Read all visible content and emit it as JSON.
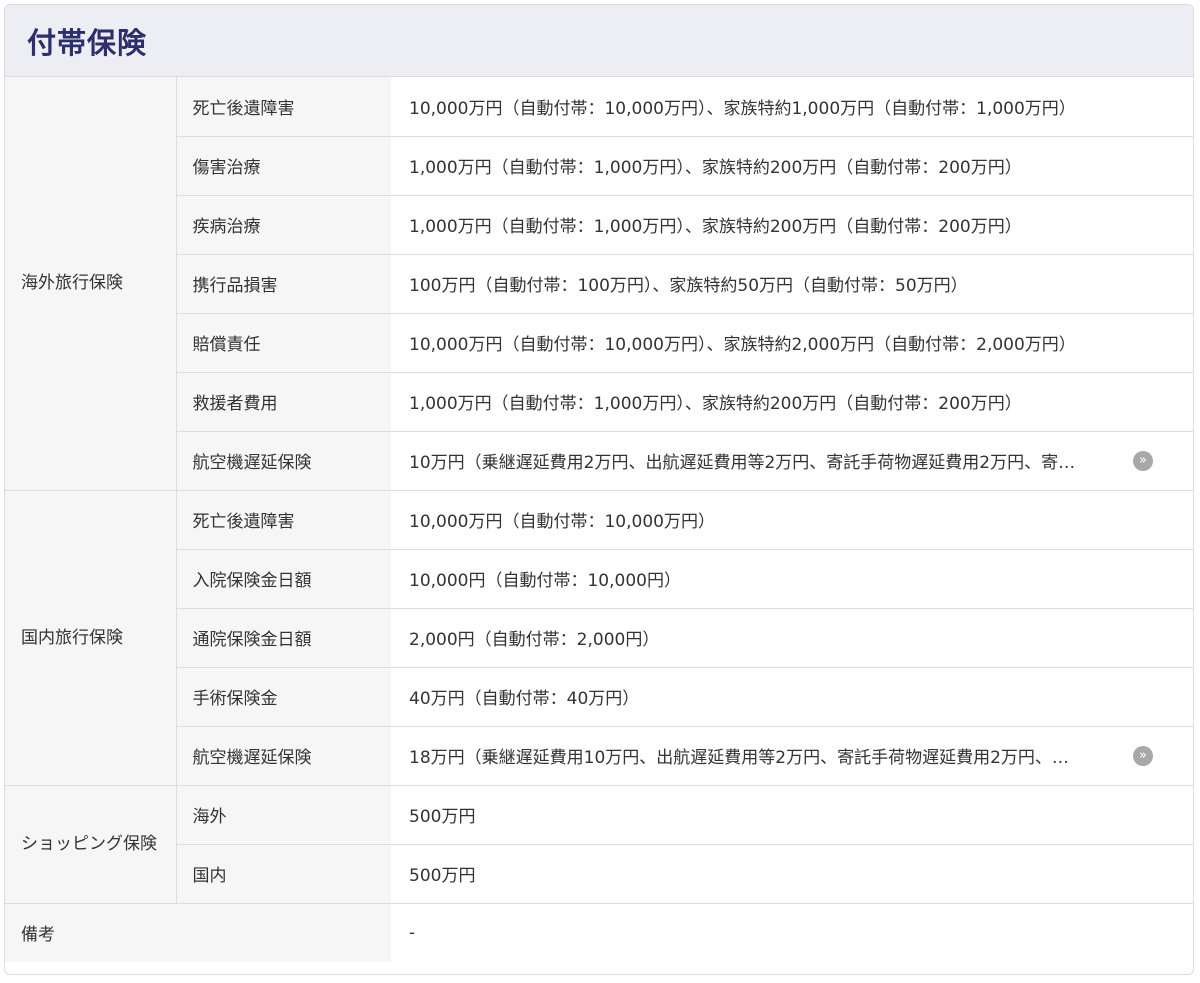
{
  "title": "付帯保険",
  "more_glyph": "»",
  "overseas": {
    "label": "海外旅行保険",
    "rows": [
      {
        "item": "死亡後遺障害",
        "value": "10,000万円（自動付帯：10,000万円）、家族特約1,000万円（自動付帯：1,000万円）"
      },
      {
        "item": "傷害治療",
        "value": "1,000万円（自動付帯：1,000万円）、家族特約200万円（自動付帯：200万円）"
      },
      {
        "item": "疾病治療",
        "value": "1,000万円（自動付帯：1,000万円）、家族特約200万円（自動付帯：200万円）"
      },
      {
        "item": "携行品損害",
        "value": "100万円（自動付帯：100万円）、家族特約50万円（自動付帯：50万円）"
      },
      {
        "item": "賠償責任",
        "value": "10,000万円（自動付帯：10,000万円）、家族特約2,000万円（自動付帯：2,000万円）"
      },
      {
        "item": "救援者費用",
        "value": "1,000万円（自動付帯：1,000万円）、家族特約200万円（自動付帯：200万円）"
      },
      {
        "item": "航空機遅延保険",
        "value": "10万円（乗継遅延費用2万円、出航遅延費用等2万円、寄託手荷物遅延費用2万円、寄…"
      }
    ]
  },
  "domestic": {
    "label": "国内旅行保険",
    "rows": [
      {
        "item": "死亡後遺障害",
        "value": "10,000万円（自動付帯：10,000万円）"
      },
      {
        "item": "入院保険金日額",
        "value": "10,000円（自動付帯：10,000円）"
      },
      {
        "item": "通院保険金日額",
        "value": "2,000円（自動付帯：2,000円）"
      },
      {
        "item": "手術保険金",
        "value": "40万円（自動付帯：40万円）"
      },
      {
        "item": "航空機遅延保険",
        "value": "18万円（乗継遅延費用10万円、出航遅延費用等2万円、寄託手荷物遅延費用2万円、…"
      }
    ]
  },
  "shopping": {
    "label": "ショッピング保険",
    "rows": [
      {
        "item": "海外",
        "value": "500万円"
      },
      {
        "item": "国内",
        "value": "500万円"
      }
    ]
  },
  "remarks": {
    "label": "備考",
    "value": "-"
  }
}
